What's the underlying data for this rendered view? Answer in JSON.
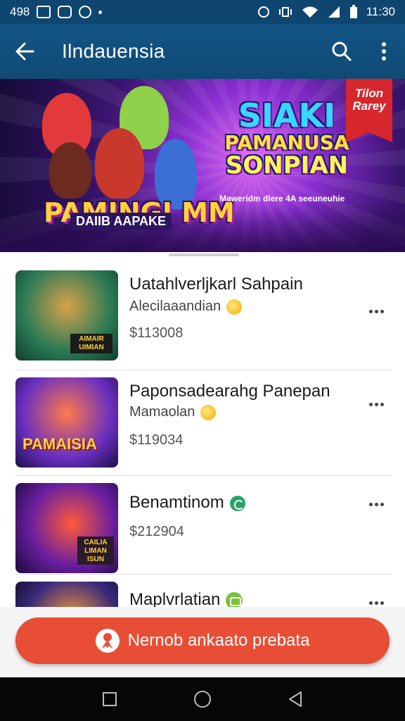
{
  "status_bar": {
    "left_text": "498",
    "time": "11:30",
    "icons": [
      "image-icon",
      "game-icon",
      "sync-icon",
      "dot-icon",
      "alarm-icon",
      "vibrate-icon",
      "wifi-icon",
      "signal-icon",
      "battery-icon"
    ]
  },
  "app_bar": {
    "title": "Ilndauensia",
    "icons": [
      "back-arrow-icon",
      "search-icon",
      "more-vertical-icon"
    ]
  },
  "banner": {
    "left_title": "PAMINGI MM",
    "left_subtitle": "DAIIB AAPAKE",
    "headline_line1": "SIAKI",
    "headline_line2": "PAMANUSA",
    "headline_line3": "SONPIAN",
    "headline_sub": "Maweridm dlere 4A seeuneuhie",
    "ribbon": "Tilon Rarey"
  },
  "items": [
    {
      "title": "Uatahlverljkarl Sahpain",
      "subtitle": "Alecilaaandian",
      "price": "$113008",
      "badge": "coin"
    },
    {
      "title": "Paponsadearahg Panepan",
      "subtitle": "Mamaolan",
      "price": "$119034",
      "badge": "coin"
    },
    {
      "title": "Benamtinom",
      "subtitle": "",
      "price": "$212904",
      "badge": "green"
    },
    {
      "title": "Maplvrlatian",
      "subtitle": "",
      "price": "",
      "badge": "lime"
    }
  ],
  "thumb_labels": [
    "AIMAIR UIMIAN",
    "PAMAISIA",
    "CAILIA LIMAN ISUN",
    ""
  ],
  "cta": {
    "label": "Nernob ankaato prebata"
  },
  "nav_bar": {
    "icons": [
      "recents-square-icon",
      "home-circle-icon",
      "back-triangle-icon"
    ]
  },
  "colors": {
    "status_bar": "#0f4670",
    "app_bar": "#135585",
    "cta": "#e84d36",
    "nav": "#060606"
  }
}
